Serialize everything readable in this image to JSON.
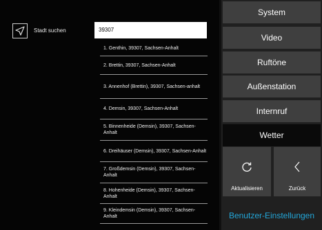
{
  "search": {
    "label": "Stadt suchen",
    "value": "39307",
    "results": [
      "1. Genthin, 39307, Sachsen-Anhalt",
      "2. Brettin, 39307, Sachsen-Anhalt",
      "3. Annenhof (Brettin), 39307, Sachsen-anhalt",
      "4. Demsin, 39307, Sachsen-Anhalt",
      "5. Binnenheide (Demsin), 39307, Sachsen-Anhalt",
      "6. Dreihäuser (Demsin), 39307, Sachsen-Anhalt",
      "7. Großdemsin (Demsin), 39307, Sachsen-Anhalt",
      "8. Hohenheide (Demsin), 39307, Sachsen-Anhalt",
      "9. Kleindemsin (Demsin), 39307, Sachsen-Anhalt"
    ]
  },
  "menu": {
    "system": "System",
    "video": "Video",
    "ringtones": "Ruftöne",
    "outdoor": "Außenstation",
    "intercom": "Internruf",
    "weather": "Wetter",
    "active": "Wetter"
  },
  "actions": {
    "refresh": "Aktualisieren",
    "back": "Zurück",
    "refresh_icon": "refresh-icon",
    "back_icon": "chevron-left-icon"
  },
  "footer": {
    "user_settings": "Benutzer-Einstellungen"
  },
  "colors": {
    "accent": "#23a9dc",
    "button": "#3f3f3f",
    "panel": "#202020",
    "background": "#050505"
  }
}
